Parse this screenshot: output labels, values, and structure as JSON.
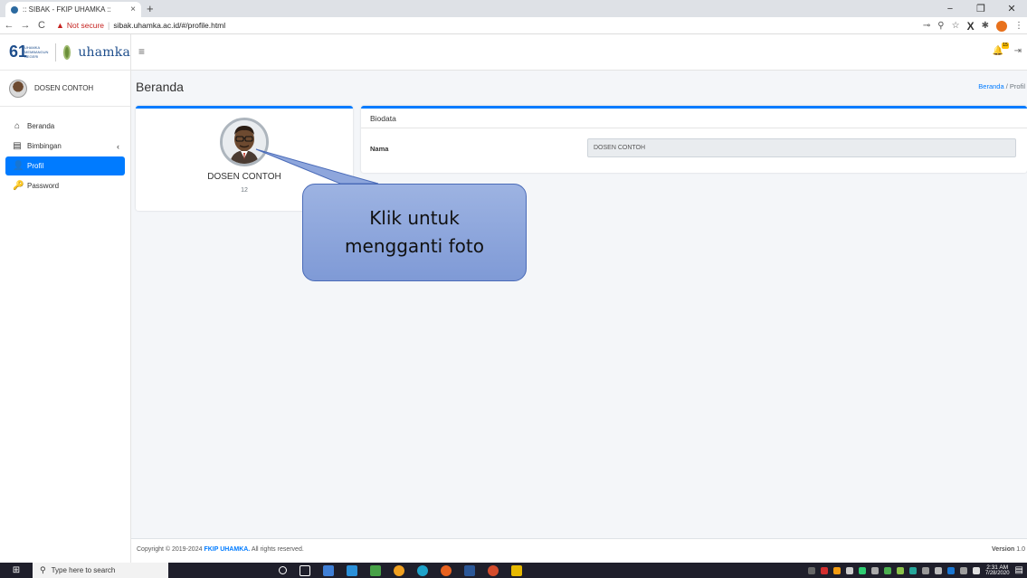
{
  "browser": {
    "tab_title": ":: SIBAK - FKIP UHAMKA ::",
    "tab_close": "×",
    "new_tab": "+",
    "minimize": "−",
    "maximize": "❐",
    "close": "✕",
    "back": "←",
    "forward": "→",
    "reload": "C",
    "security_label": "Not secure",
    "separator": "|",
    "url": "sibak.uhamka.ac.id/#/profile.html",
    "key_icon": "⊸",
    "zoom_icon": "⚲",
    "star_icon": "☆",
    "ext_x": "X",
    "puzzle_icon": "✱",
    "menu_icon": "⋮"
  },
  "brand": {
    "anniversary_number_6": "6",
    "anniversary_number_1": "1",
    "anniversary_caption": "UHAMKA MEMBANGUN NEGERI",
    "name": "uhamka"
  },
  "user": {
    "name": "DOSEN CONTOH"
  },
  "sidebar": {
    "items": [
      {
        "label": "Beranda",
        "icon": "home-icon",
        "glyph": "⌂"
      },
      {
        "label": "Bimbingan",
        "icon": "book-icon",
        "glyph": "▤",
        "chevron": "‹"
      },
      {
        "label": "Profil",
        "icon": "user-icon",
        "glyph": "👤"
      },
      {
        "label": "Password",
        "icon": "key-icon",
        "glyph": "🔑"
      }
    ]
  },
  "topnav": {
    "hamburger": "≡",
    "bell_badge": "15",
    "bell_glyph": "🔔",
    "signout_glyph": "⇥"
  },
  "page": {
    "title": "Beranda",
    "breadcrumb_home": "Beranda",
    "breadcrumb_sep": " / ",
    "breadcrumb_current": "Profil"
  },
  "profile": {
    "name": "DOSEN CONTOH",
    "id": "12"
  },
  "biodata": {
    "header": "Biodata",
    "name_label": "Nama",
    "name_value": "DOSEN CONTOH"
  },
  "callout": {
    "line1": "Klik untuk",
    "line2": "mengganti foto"
  },
  "footer": {
    "copyright_prefix": "Copyright © 2019-2024 ",
    "brand": "FKIP UHAMKA.",
    "suffix": " All rights reserved.",
    "version_label": "Version",
    "version_value": "1.0"
  },
  "taskbar": {
    "start_glyph": "⊞",
    "search_icon": "⚲",
    "search_placeholder": "Type here to search",
    "time": "2:31 AM",
    "date": "7/28/2020",
    "notif_glyph": "▤"
  },
  "colors": {
    "accent": "#007bff",
    "sidebar_bg": "#ffffff",
    "page_bg": "#f4f6f9",
    "callout_fill": "#8ea6dc",
    "taskbar_bg": "#1f1f2b"
  }
}
